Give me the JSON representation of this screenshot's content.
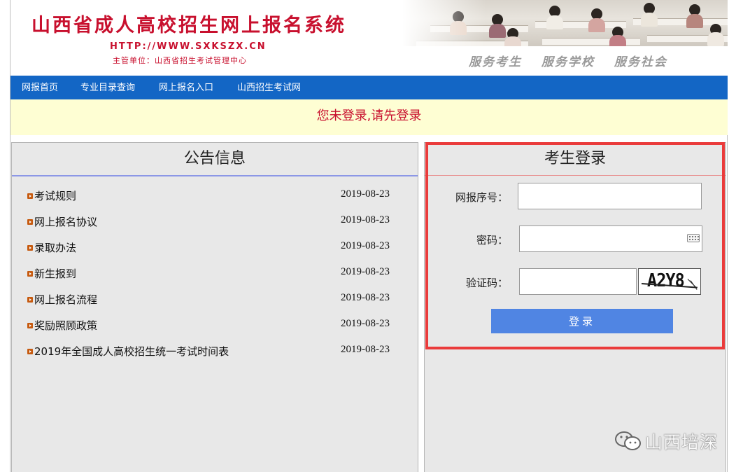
{
  "header": {
    "title": "山西省成人高校招生网上报名系统",
    "url": "HTTP://WWW.SXKSZX.CN",
    "sponsor": "主管单位：山西省招生考试管理中心",
    "slogans": [
      "服务考生",
      "服务学校",
      "服务社会"
    ]
  },
  "nav": {
    "items": [
      "网报首页",
      "专业目录查询",
      "网上报名入口",
      "山西招生考试网"
    ]
  },
  "notice_bar": {
    "text": "您未登录,请先登录"
  },
  "announcements": {
    "title": "公告信息",
    "items": [
      {
        "title": "考试规则",
        "date": "2019-08-23"
      },
      {
        "title": "网上报名协议",
        "date": "2019-08-23"
      },
      {
        "title": "录取办法",
        "date": "2019-08-23"
      },
      {
        "title": "新生报到",
        "date": "2019-08-23"
      },
      {
        "title": "网上报名流程",
        "date": "2019-08-23"
      },
      {
        "title": "奖励照顾政策",
        "date": "2019-08-23"
      },
      {
        "title": "2019年全国成人高校招生统一考试时间表",
        "date": "2019-08-23"
      }
    ]
  },
  "login": {
    "title": "考生登录",
    "serial_label": "网报序号：",
    "serial_value": "",
    "password_label": "密码：",
    "password_value": "",
    "captcha_label": "验证码：",
    "captcha_value": "",
    "captcha_image_text": "A2Y8",
    "submit_label": "登录"
  },
  "watermark": {
    "text": "山西培深"
  },
  "colors": {
    "brand_red": "#c8102e",
    "nav_blue": "#1366c5",
    "button_blue": "#5085e3",
    "highlight_red": "#ea3b3b",
    "notice_bg": "#fefed3"
  }
}
